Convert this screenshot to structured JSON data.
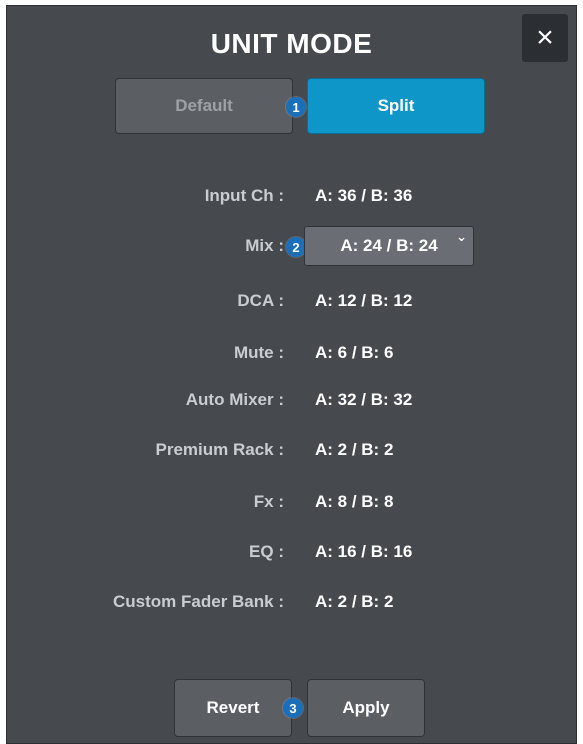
{
  "dialog": {
    "title": "UNIT MODE",
    "close_icon": "×"
  },
  "mode": {
    "default_label": "Default",
    "split_label": "Split",
    "selected": "Split"
  },
  "callouts": [
    "1",
    "2",
    "3"
  ],
  "rows": [
    {
      "label": "Input Ch :",
      "value": "A: 36 / B: 36"
    },
    {
      "label": "Mix :",
      "value": "A: 24 / B: 24"
    },
    {
      "label": "DCA :",
      "value": "A: 12 / B: 12"
    },
    {
      "label": "Mute :",
      "value": "A: 6 / B: 6"
    },
    {
      "label": "Auto Mixer :",
      "value": "A: 32 / B: 32"
    },
    {
      "label": "Premium Rack :",
      "value": "A: 2 / B: 2"
    },
    {
      "label": "Fx :",
      "value": "A: 8 / B: 8"
    },
    {
      "label": "EQ :",
      "value": "A: 16 / B: 16"
    },
    {
      "label": "Custom Fader Bank :",
      "value": "A: 2 / B: 2"
    }
  ],
  "footer": {
    "revert_label": "Revert",
    "apply_label": "Apply"
  },
  "colors": {
    "panel": "#464a4f",
    "accent": "#0e96c9",
    "callout": "#1b6fb8"
  }
}
